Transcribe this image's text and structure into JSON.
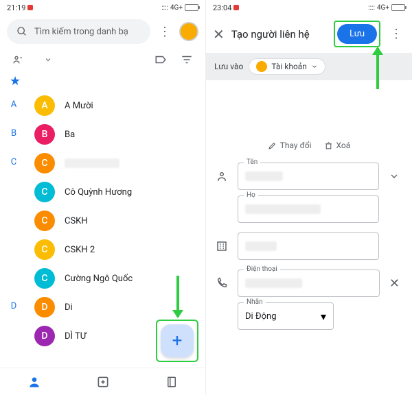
{
  "left": {
    "status": {
      "time": "21:19",
      "signal": "4G+"
    },
    "search": {
      "placeholder": "Tìm kiếm trong danh bạ"
    },
    "contacts": {
      "A": [
        {
          "initial": "A",
          "color": "#fbbc04",
          "name": "A Mười"
        }
      ],
      "B": [
        {
          "initial": "B",
          "color": "#e91e63",
          "name": "Ba"
        }
      ],
      "C": [
        {
          "initial": "C",
          "color": "#fb8c00",
          "name": ""
        },
        {
          "initial": "C",
          "color": "#00bcd4",
          "name": "Cô Quỳnh Hương"
        },
        {
          "initial": "C",
          "color": "#fb8c00",
          "name": "CSKH"
        },
        {
          "initial": "C",
          "color": "#fbbc04",
          "name": "CSKH 2"
        },
        {
          "initial": "C",
          "color": "#00bcd4",
          "name": "Cường Ngô Quốc"
        }
      ],
      "D": [
        {
          "initial": "D",
          "color": "#fb8c00",
          "name": "Di"
        },
        {
          "initial": "D",
          "color": "#9c27b0",
          "name": "DÌ TƯ"
        }
      ]
    }
  },
  "right": {
    "status": {
      "time": "23:04",
      "signal": "4G+"
    },
    "header": {
      "title": "Tạo người liên hệ",
      "save": "Lưu"
    },
    "saveinto": {
      "label": "Lưu vào",
      "account": "Tài khoản"
    },
    "actions": {
      "change": "Thay đổi",
      "delete": "Xoá"
    },
    "fields": {
      "firstname": "Tên",
      "lastname": "Họ",
      "company": "",
      "phone": "Điện thoại",
      "label": "Nhãn",
      "label_value": "Di Động"
    }
  }
}
